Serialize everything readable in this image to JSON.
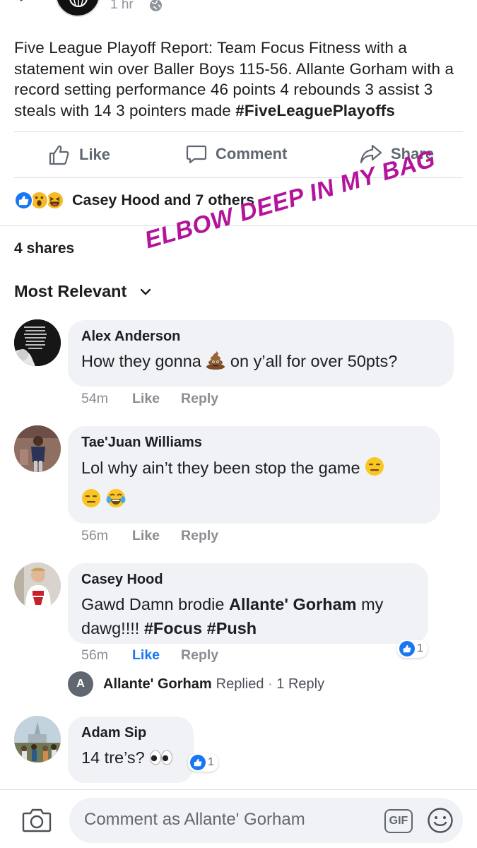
{
  "post": {
    "time": "1 hr",
    "text_segments": [
      "Five League Playoff Report: Team Focus Fitness with a statement win over Baller Boys 115-56. Allante Gorham with a record setting performance 46 points 4 rebounds 3 assist 3 steals with 14 3 pointers made ",
      "#FiveLeaguePlayoffs"
    ]
  },
  "actions": {
    "like": "Like",
    "comment": "Comment",
    "share": "Share"
  },
  "reactions": {
    "icons": [
      "like-icon",
      "wow-icon",
      "haha-icon"
    ],
    "summary": "Casey Hood and 7 others"
  },
  "shares": "4 shares",
  "sticker": "ELBOW DEEP IN MY BAG",
  "sort": {
    "label": "Most Relevant"
  },
  "comments": [
    {
      "name": "Alex Anderson",
      "text_before": "How they gonna ",
      "emoji": "poop",
      "text_after": " on y’all for over 50pts?",
      "time": "54m",
      "like": "Like",
      "reply": "Reply"
    },
    {
      "name": "Tae'Juan Williams",
      "text": "Lol why ain’t they been stop the game ",
      "emojis": [
        "expressionless",
        "expressionless",
        "joy"
      ],
      "time": "56m",
      "like": "Like",
      "reply": "Reply"
    },
    {
      "name": "Casey Hood",
      "text_before": "Gawd Damn brodie ",
      "mention": "Allante' Gorham",
      "text_mid": " my dawg!!!! ",
      "tags": "#Focus #Push",
      "time": "56m",
      "like": "Like",
      "reply": "Reply",
      "reaction_count": "1",
      "liked": true
    },
    {
      "name": "Adam Sip",
      "text": "14 tre’s? ",
      "emoji": "eyes",
      "reaction_count": "1"
    }
  ],
  "reply_summary": {
    "avatar_letter": "A",
    "name": "Allante' Gorham",
    "action": "Replied",
    "separator": "·",
    "count": "1 Reply"
  },
  "composer": {
    "placeholder": "Comment as Allante' Gorham",
    "gif": "GIF"
  },
  "colors": {
    "accent": "#1877f2",
    "sticker": "#b3149b",
    "bubble": "#f0f2f5"
  }
}
